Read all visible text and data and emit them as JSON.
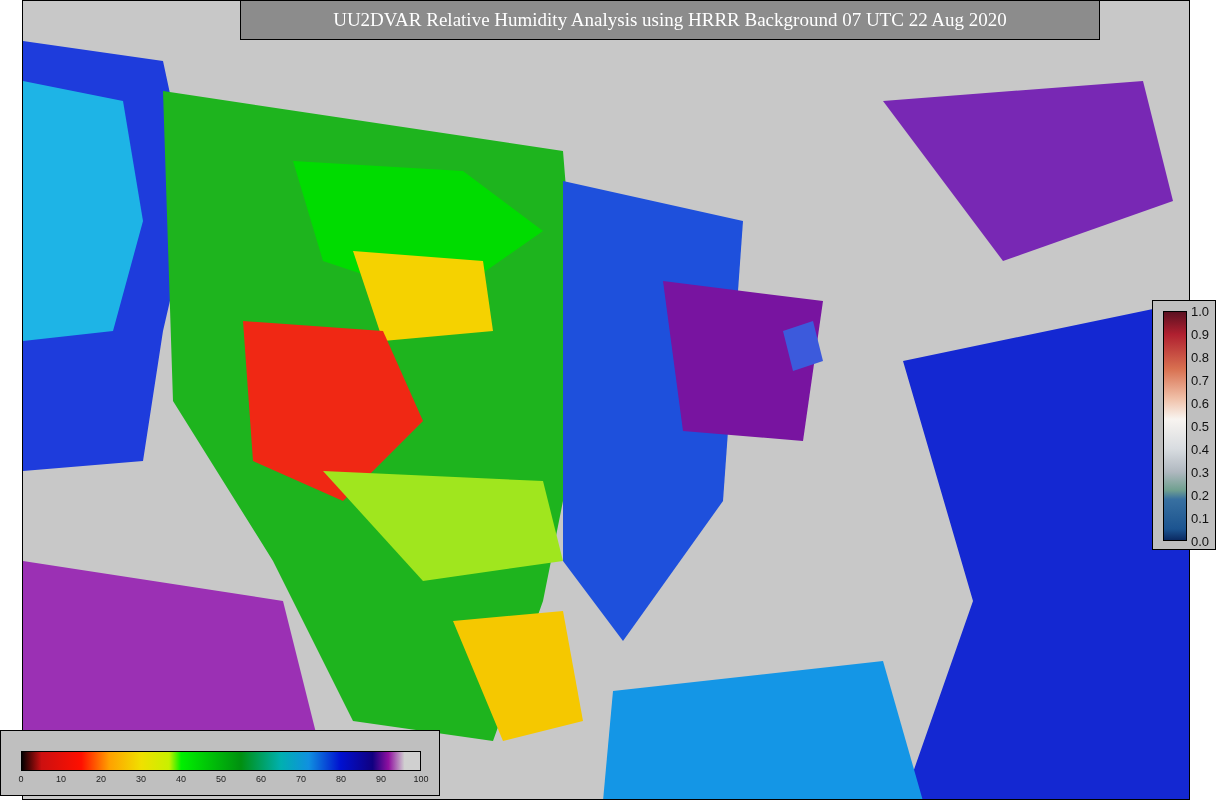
{
  "title": "UU2DVAR Relative Humidity Analysis using HRRR Background 07 UTC 22 Aug 2020",
  "humidity_colorbar": {
    "ticks": [
      "0",
      "10",
      "20",
      "30",
      "40",
      "50",
      "60",
      "70",
      "80",
      "90",
      "100"
    ]
  },
  "observation_colorbar": {
    "ticks": [
      "1.0",
      "0.9",
      "0.8",
      "0.7",
      "0.6",
      "0.5",
      "0.4",
      "0.3",
      "0.2",
      "0.1",
      "0.0"
    ]
  }
}
